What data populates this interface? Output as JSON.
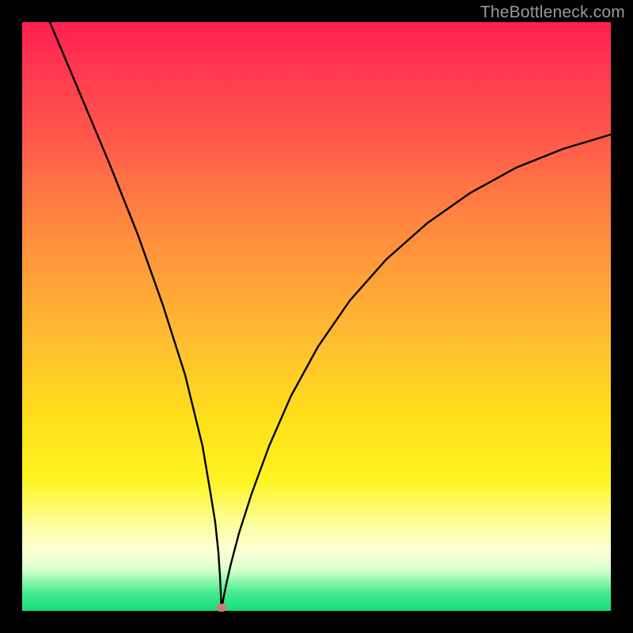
{
  "watermark": "TheBottleneck.com",
  "chart_data": {
    "type": "line",
    "title": "",
    "xlabel": "",
    "ylabel": "",
    "xlim": [
      0,
      100
    ],
    "ylim": [
      0,
      100
    ],
    "grid": false,
    "legend": false,
    "background_gradient_stops": [
      {
        "pos": 0,
        "color": "#ff1f4f"
      },
      {
        "pos": 20,
        "color": "#ff5a4b"
      },
      {
        "pos": 44,
        "color": "#ffa238"
      },
      {
        "pos": 68,
        "color": "#ffe119"
      },
      {
        "pos": 86,
        "color": "#fdffa8"
      },
      {
        "pos": 93,
        "color": "#d8ffcd"
      },
      {
        "pos": 100,
        "color": "#14e07a"
      }
    ],
    "series": [
      {
        "name": "bottleneck-curve-left",
        "x": [
          0,
          4,
          8,
          12,
          16,
          20,
          24,
          28,
          30,
          32,
          33
        ],
        "y": [
          100,
          88,
          76,
          64,
          52,
          40,
          28,
          15,
          8,
          3,
          0
        ]
      },
      {
        "name": "bottleneck-curve-right",
        "x": [
          33,
          35,
          38,
          42,
          46,
          50,
          55,
          60,
          66,
          72,
          80,
          88,
          96,
          100
        ],
        "y": [
          0,
          6,
          15,
          25,
          33,
          40,
          47,
          53,
          59,
          64,
          69,
          73,
          77,
          79
        ]
      }
    ],
    "marker": {
      "x": 33,
      "y": 0,
      "color": "#cb7e74"
    }
  }
}
